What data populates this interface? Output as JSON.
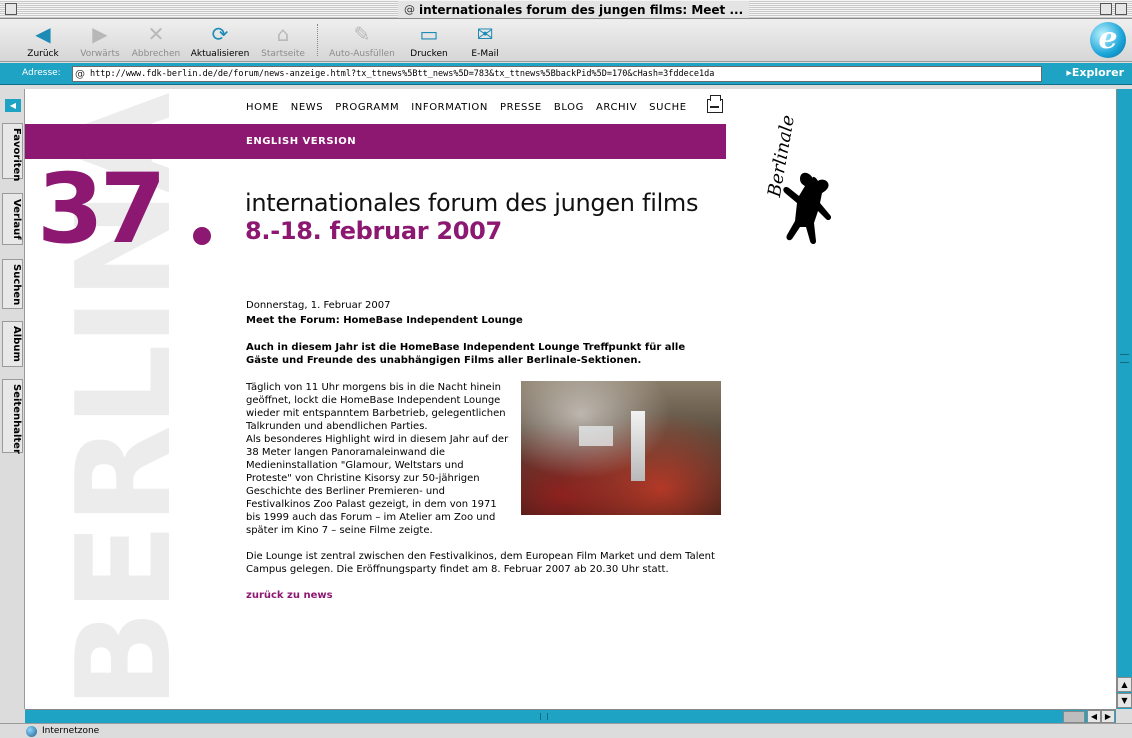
{
  "window": {
    "title": "internationales forum des jungen films: Meet ..."
  },
  "toolbar": {
    "back": "Zurück",
    "forward": "Vorwärts",
    "stop": "Abbrechen",
    "refresh": "Aktualisieren",
    "home": "Startseite",
    "autofill": "Auto-Ausfüllen",
    "print": "Drucken",
    "email": "E-Mail"
  },
  "address_bar": {
    "label": "Adresse:",
    "url": "http://www.fdk-berlin.de/de/forum/news-anzeige.html?tx_ttnews%5Btt_news%5D=783&tx_ttnews%5BbackPid%5D=170&cHash=3fddece1da",
    "explorer_button": "Explorer"
  },
  "sidebar_tabs": [
    "Favoriten",
    "Verlauf",
    "Suchen",
    "Album",
    "Seitenhalter"
  ],
  "status_bar": {
    "zone": "Internetzone"
  },
  "page": {
    "nav": [
      "HOME",
      "NEWS",
      "PROGRAMM",
      "INFORMATION",
      "PRESSE",
      "BLOG",
      "ARCHIV",
      "SUCHE"
    ],
    "english_version": "ENGLISH VERSION",
    "edition_number": "37",
    "watermark_text": "BERLINALE",
    "title": "internationales forum des jungen films",
    "dates": "8.-18. februar 2007",
    "logo_word": "Berlinale",
    "article": {
      "date": "Donnerstag, 1. Februar 2007",
      "headline": "Meet the Forum: HomeBase Independent Lounge",
      "lead": "Auch in diesem Jahr ist die HomeBase Independent Lounge Treffpunkt für alle Gäste und Freunde des unabhängigen Films aller Berlinale-Sektionen.",
      "paragraph_1": "Täglich von 11 Uhr morgens bis in die Nacht hinein geöffnet, lockt die HomeBase Independent Lounge wieder mit entspanntem Barbetrieb, gelegentlichen Talkrunden und abendlichen Parties.",
      "paragraph_2": "Als besonderes Highlight wird in diesem Jahr auf der 38 Meter langen Panoramaleinwand die Medieninstallation \"Glamour, Weltstars und Proteste\" von Christine Kisorsy zur 50-jährigen Geschichte des Berliner Premieren- und Festivalkinos Zoo Palast gezeigt, in dem von 1971 bis 1999 auch das Forum – im Atelier am Zoo und später im Kino 7 – seine Filme zeigte.",
      "paragraph_3": "Die Lounge ist zentral zwischen den Festivalkinos, dem European Film Market und dem Talent Campus gelegen. Die Eröffnungsparty findet am 8. Februar 2007 ab 20.30 Uhr statt.",
      "back_link": "zurück zu news"
    }
  },
  "colors": {
    "brand_purple": "#8c1871",
    "chrome_teal": "#1fa3c4"
  }
}
